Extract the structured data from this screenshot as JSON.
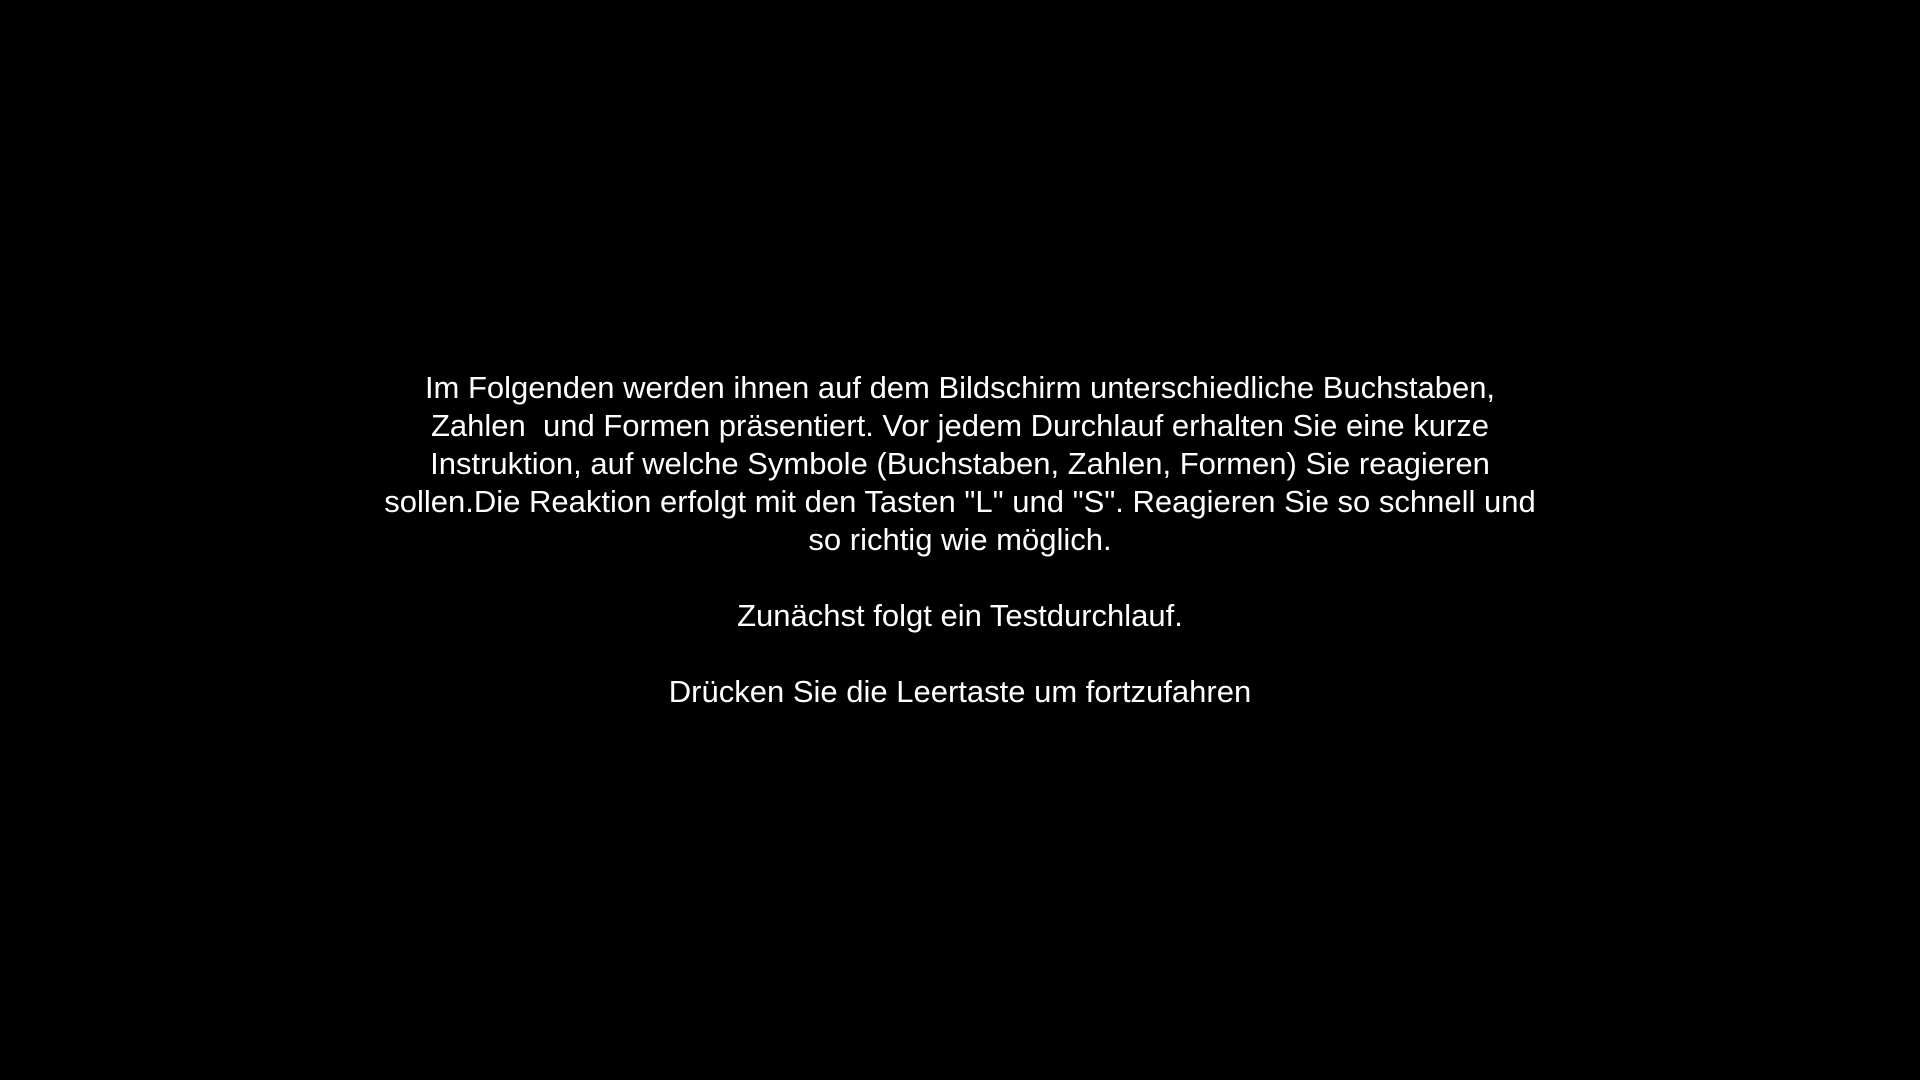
{
  "colors": {
    "background": "#000000",
    "text": "#ffffff"
  },
  "instruction_lines": [
    "Im Folgenden werden ihnen auf dem Bildschirm unterschiedliche Buchstaben,",
    "Zahlen  und Formen präsentiert. Vor jedem Durchlauf erhalten Sie eine kurze",
    "Instruktion, auf welche Symbole (Buchstaben, Zahlen, Formen) Sie reagieren",
    "sollen.Die Reaktion erfolgt mit den Tasten \"L\" und \"S\". Reagieren Sie so schnell und",
    "so richtig wie möglich."
  ],
  "test_notice": "Zunächst folgt ein Testdurchlauf.",
  "continue_prompt": "Drücken Sie die Leertaste um fortzufahren"
}
